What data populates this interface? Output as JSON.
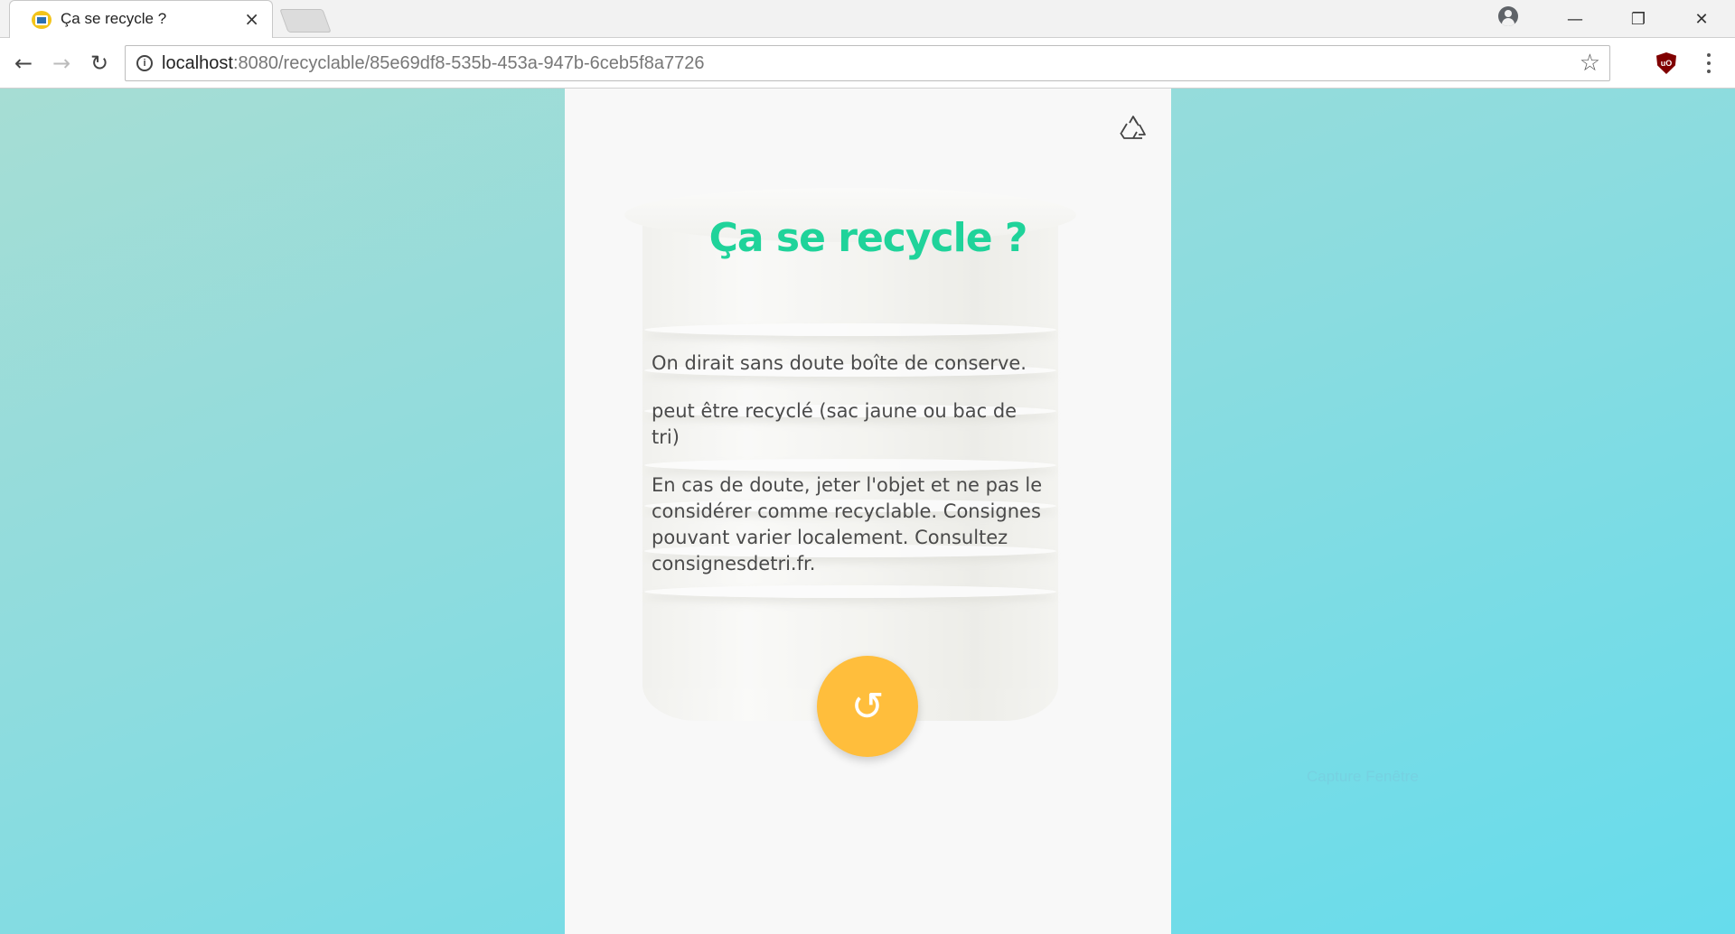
{
  "browser": {
    "tab_title": "Ça se recycle ?",
    "tab_close": "×",
    "url_host": "localhost",
    "url_rest": ":8080/recyclable/85e69df8-535b-453a-947b-6ceb5f8a7726",
    "info_icon": "i",
    "star": "☆",
    "extension_label": "uO",
    "window_controls": {
      "minimize": "—",
      "restore": "❐",
      "close": "✕"
    },
    "nav": {
      "back": "←",
      "forward": "→",
      "reload": "↻"
    }
  },
  "page": {
    "title": "Ça se recycle ?",
    "paragraphs": [
      "On dirait sans doute boîte de conserve.",
      "peut être recyclé (sac jaune ou bac de tri)",
      "En cas de doute, jeter l'objet et ne pas le considérer comme recyclable. Consignes pouvant varier localement. Consultez consignesdetri.fr."
    ],
    "reload_symbol": "↺",
    "watermark": "Capture Fenêtre"
  },
  "colors": {
    "title": "#1fd39a",
    "reload_button": "#ffbe3c",
    "text": "#4a4a4a",
    "card": "#f8f8f8"
  },
  "icons": [
    "recycle-icon",
    "reload-icon",
    "info-icon",
    "star-icon",
    "profile-icon",
    "ublock-icon"
  ]
}
